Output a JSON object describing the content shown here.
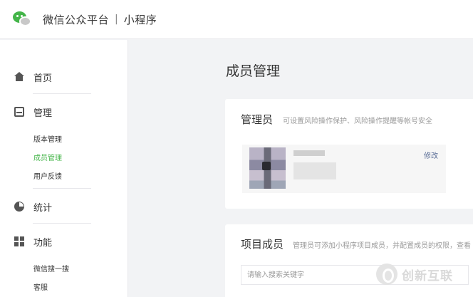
{
  "header": {
    "platform_title": "微信公众平台",
    "separator": "|",
    "section_title": "小程序"
  },
  "sidebar": {
    "home": {
      "label": "首页",
      "icon": "home-icon"
    },
    "manage": {
      "label": "管理",
      "icon": "manage-icon",
      "items": [
        {
          "label": "版本管理",
          "active": false
        },
        {
          "label": "成员管理",
          "active": true
        },
        {
          "label": "用户反馈",
          "active": false
        }
      ]
    },
    "stats": {
      "label": "统计",
      "icon": "stats-icon"
    },
    "features": {
      "label": "功能",
      "icon": "features-icon",
      "items": [
        {
          "label": "微信搜一搜"
        },
        {
          "label": "客服"
        }
      ]
    }
  },
  "main": {
    "page_title": "成员管理",
    "admin_card": {
      "title": "管理员",
      "description": "可设置风险操作保护、风险操作提醒等帐号安全",
      "edit_label": "修改"
    },
    "members_card": {
      "title": "项目成员",
      "description": "管理员可添加小程序项目成员，并配置成员的权限，查看",
      "search_placeholder": "请输入搜索关键字"
    }
  },
  "watermark": {
    "text": "创新互联"
  },
  "colors": {
    "accent_green": "#44b549",
    "link_blue": "#576b95",
    "page_bg": "#f2f3f5"
  }
}
